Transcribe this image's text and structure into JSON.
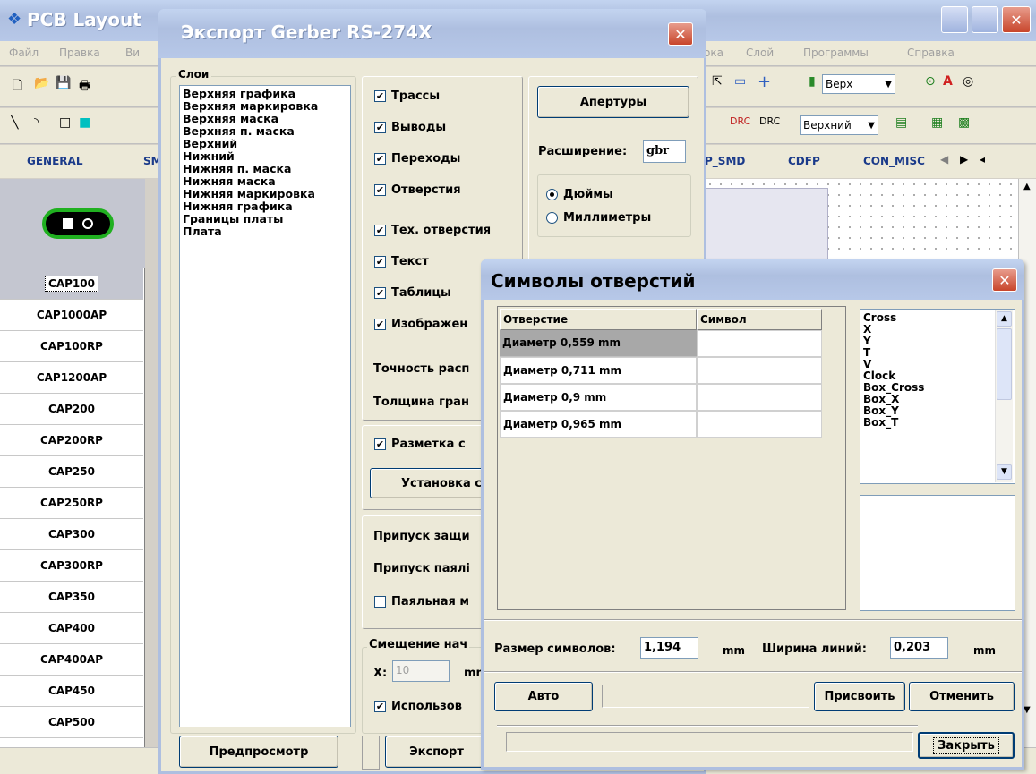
{
  "main_window": {
    "title": "PCB Layout",
    "menu": [
      "Файл",
      "Правка",
      "Ви",
      "ока",
      "Слой",
      "Программы",
      "Справка"
    ],
    "layer_select": "Верх",
    "layer_select2": "Верхний",
    "lib_tabs": [
      "GENERAL",
      "SM",
      "P_SMD",
      "CDFP",
      "CON_MISC"
    ],
    "components": [
      "CAP100",
      "CAP1000AP",
      "CAP100RP",
      "CAP1200AP",
      "CAP200",
      "CAP200RP",
      "CAP250",
      "CAP250RP",
      "CAP300",
      "CAP300RP",
      "CAP350",
      "CAP400",
      "CAP400AP",
      "CAP450",
      "CAP500"
    ],
    "selected_component": "CAP100"
  },
  "gerber_dialog": {
    "title": "Экспорт Gerber RS-274X",
    "layers_group": "Слои",
    "layers": [
      "Верхняя графика",
      "Верхняя маркировка",
      "Верхняя маска",
      "Верхняя п. маска",
      "Верхний",
      "Нижний",
      "Нижняя п. маска",
      "Нижняя маска",
      "Нижняя маркировка",
      "Нижняя графика",
      "Границы платы",
      "Плата"
    ],
    "checks": [
      "Трассы",
      "Выводы",
      "Переходы",
      "Отверстия",
      "Тех. отверстия",
      "Текст",
      "Таблицы",
      "Изображен"
    ],
    "accuracy_label": "Точность расп",
    "thickness_label": "Толщина гран",
    "markup_check": "Разметка с",
    "setup_button": "Установка с",
    "clearance_mask": "Припуск защи",
    "clearance_paste": "Припуск паялі",
    "paste_check": "Паяльная м",
    "offset_group": "Смещение нач",
    "x_label": "X:",
    "x_value": "10",
    "x_unit": "mm",
    "use_check": "Использов",
    "apertures_button": "Апертуры",
    "extension_label": "Расширение:",
    "extension_value": "gbr",
    "unit_inches": "Дюймы",
    "unit_mm": "Миллиметры",
    "preview_button": "Предпросмотр",
    "export_button": "Экспорт"
  },
  "drill_dialog": {
    "title": "Символы отверстий",
    "col_hole": "Отверстие",
    "col_symbol": "Символ",
    "rows": [
      {
        "hole": "Диаметр 0,559 mm",
        "symbol": ""
      },
      {
        "hole": "Диаметр 0,711 mm",
        "symbol": ""
      },
      {
        "hole": "Диаметр 0,9 mm",
        "symbol": ""
      },
      {
        "hole": "Диаметр 0,965 mm",
        "symbol": ""
      }
    ],
    "symbols": [
      "Cross",
      "X",
      "Y",
      "T",
      "V",
      "Clock",
      "Box_Cross",
      "Box_X",
      "Box_Y",
      "Box_T"
    ],
    "size_label": "Размер символов:",
    "size_value": "1,194",
    "size_unit": "mm",
    "width_label": "Ширина линий:",
    "width_value": "0,203",
    "width_unit": "mm",
    "auto_button": "Авто",
    "assign_button": "Присвоить",
    "cancel_button": "Отменить",
    "close_button": "Закрыть"
  }
}
